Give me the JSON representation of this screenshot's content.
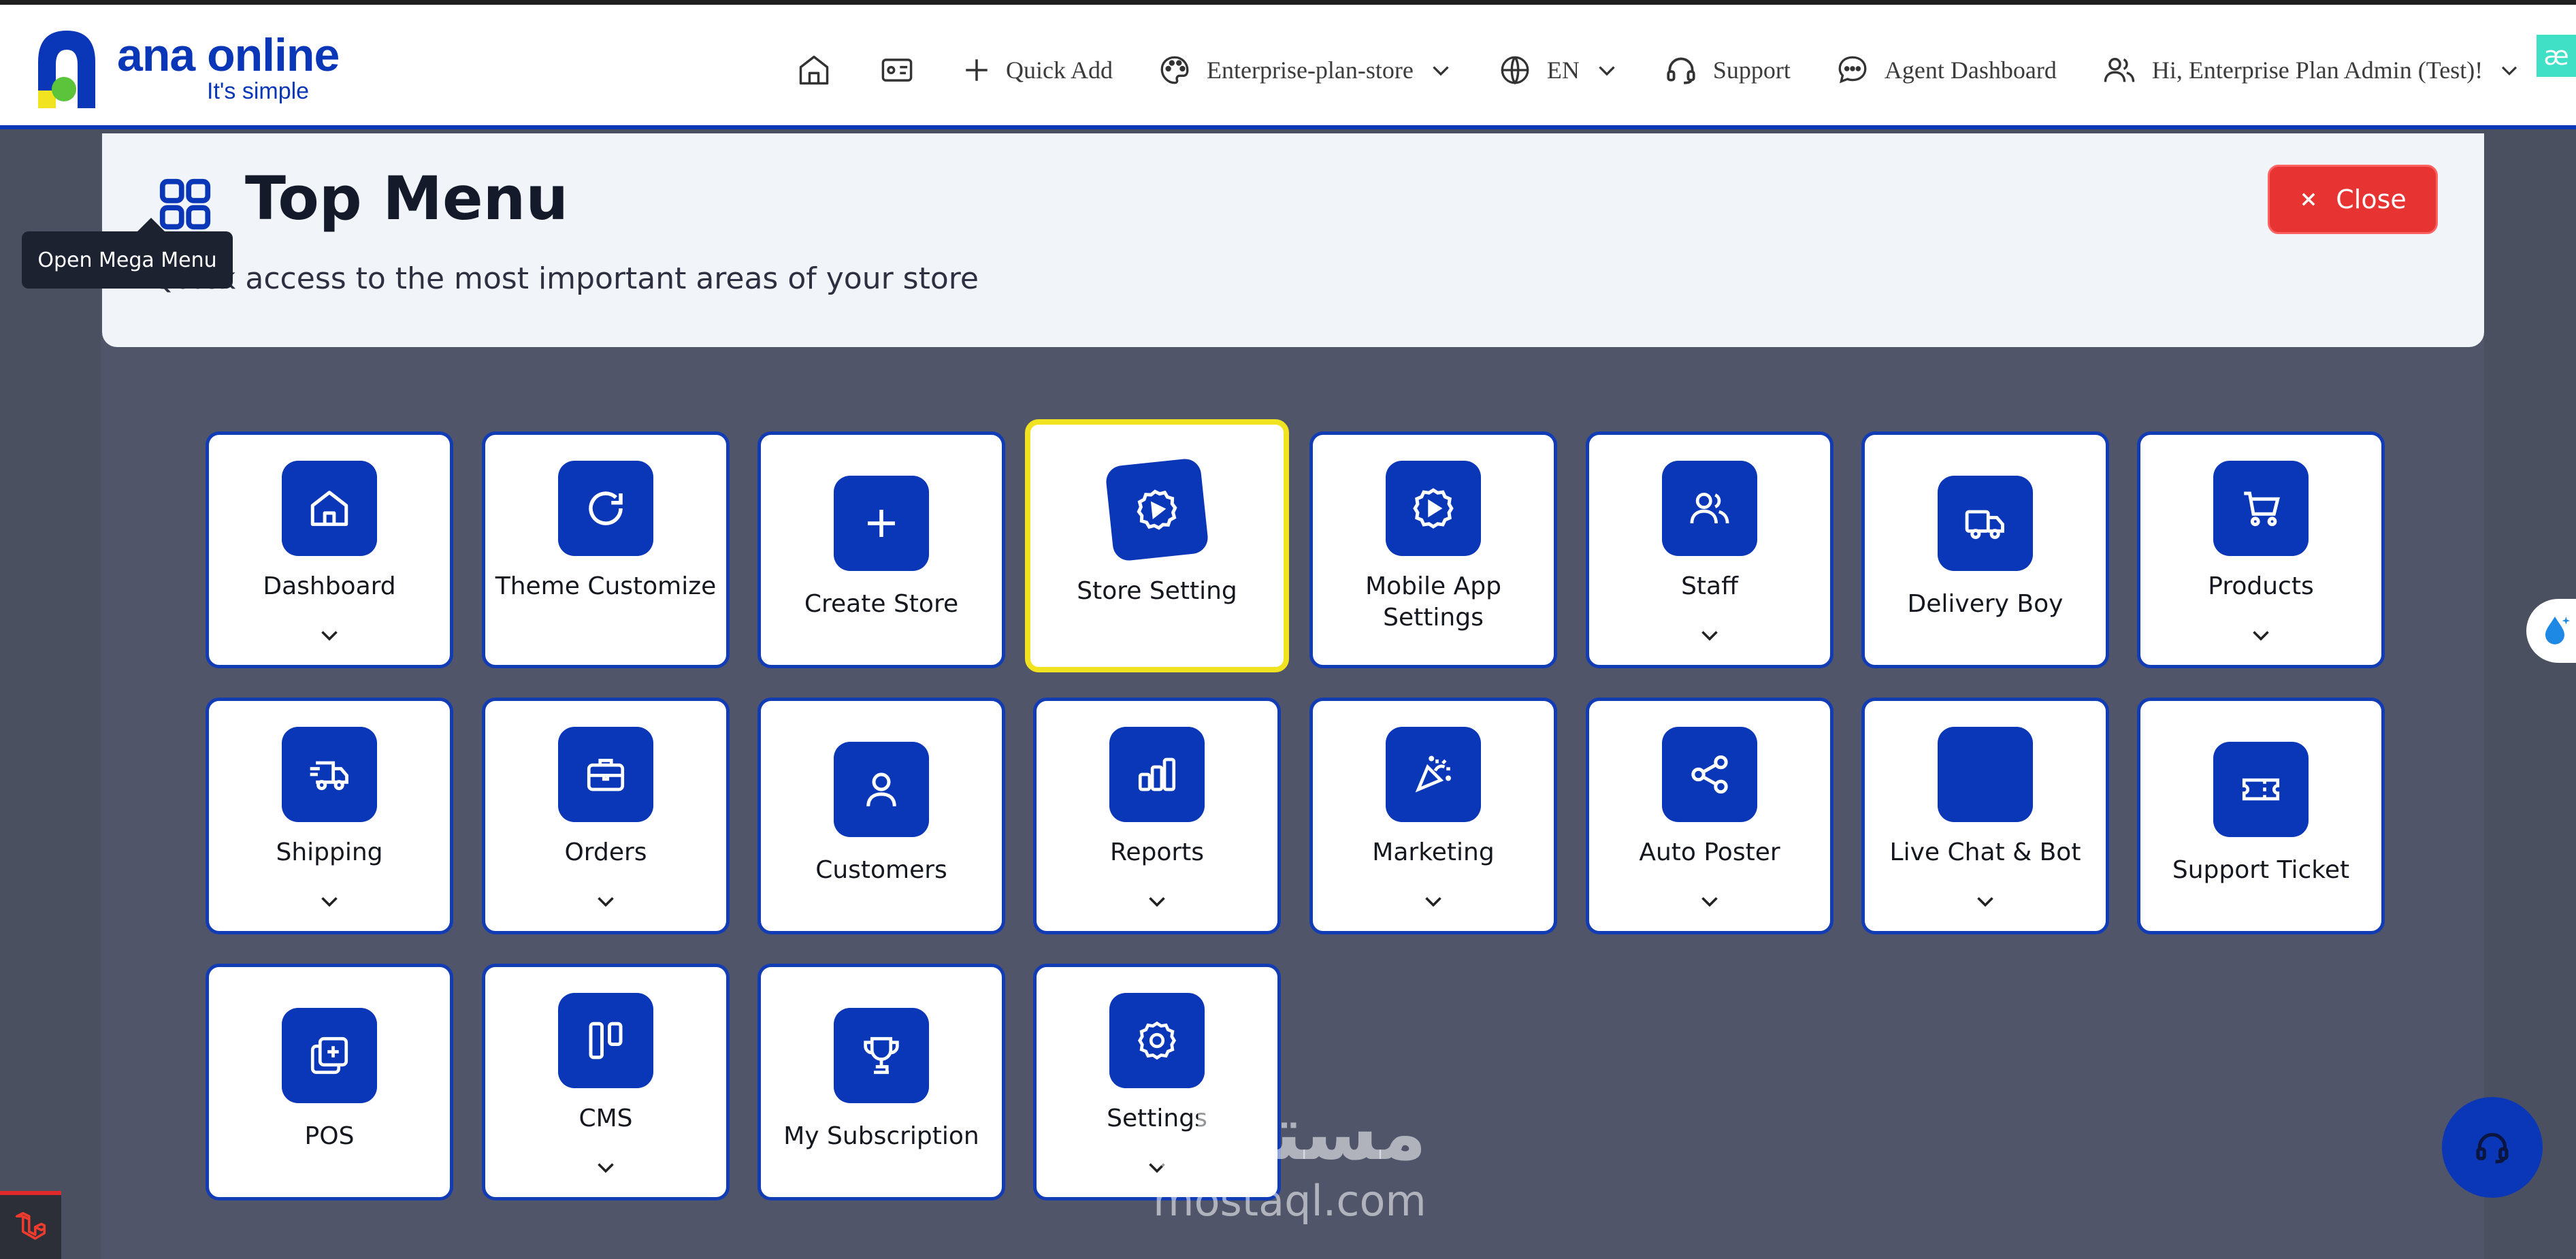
{
  "brand": {
    "name": "ana online",
    "tagline": "It's simple",
    "primary_color": "#0a36b8",
    "accent_green": "#5bc43a",
    "accent_yellow": "#f1e31f"
  },
  "nav": {
    "home_icon": "home-icon",
    "card_icon": "card-icon",
    "quick_add": "Quick Add",
    "store": "Enterprise-plan-store",
    "language": "EN",
    "support": "Support",
    "agent_dashboard": "Agent Dashboard",
    "user_greeting": "Hi, Enterprise Plan Admin (Test)!",
    "corner_badge": "æ"
  },
  "menu": {
    "title": "Top Menu",
    "subtitle": "Quick access to the most important areas of your store",
    "close_label": "Close",
    "tooltip": "Open Mega Menu"
  },
  "tiles": [
    {
      "label": "Dashboard",
      "icon": "home-icon",
      "dropdown": true
    },
    {
      "label": "Theme Customize",
      "icon": "refresh-icon",
      "dropdown": false
    },
    {
      "label": "Create Store",
      "icon": "plus-icon",
      "dropdown": false
    },
    {
      "label": "Store Setting",
      "icon": "gear-play-icon",
      "dropdown": false,
      "active": true
    },
    {
      "label": "Mobile App Settings",
      "icon": "gear-play-icon",
      "dropdown": false
    },
    {
      "label": "Staff",
      "icon": "users-icon",
      "dropdown": true
    },
    {
      "label": "Delivery Boy",
      "icon": "truck-icon",
      "dropdown": false
    },
    {
      "label": "Products",
      "icon": "cart-icon",
      "dropdown": true
    },
    {
      "label": "Shipping",
      "icon": "fast-truck-icon",
      "dropdown": true
    },
    {
      "label": "Orders",
      "icon": "briefcase-icon",
      "dropdown": true
    },
    {
      "label": "Customers",
      "icon": "user-icon",
      "dropdown": false
    },
    {
      "label": "Reports",
      "icon": "bar-chart-icon",
      "dropdown": true
    },
    {
      "label": "Marketing",
      "icon": "party-icon",
      "dropdown": true
    },
    {
      "label": "Auto Poster",
      "icon": "share-icon",
      "dropdown": true
    },
    {
      "label": "Live Chat & Bot",
      "icon": "",
      "dropdown": true
    },
    {
      "label": "Support Ticket",
      "icon": "ticket-icon",
      "dropdown": false
    },
    {
      "label": "POS",
      "icon": "pos-icon",
      "dropdown": false
    },
    {
      "label": "CMS",
      "icon": "columns-icon",
      "dropdown": true
    },
    {
      "label": "My Subscription",
      "icon": "trophy-icon",
      "dropdown": false
    },
    {
      "label": "Settings",
      "icon": "gear-icon",
      "dropdown": true
    }
  ],
  "watermark": {
    "arabic": "مستقل",
    "latin": "mostaql.com"
  }
}
